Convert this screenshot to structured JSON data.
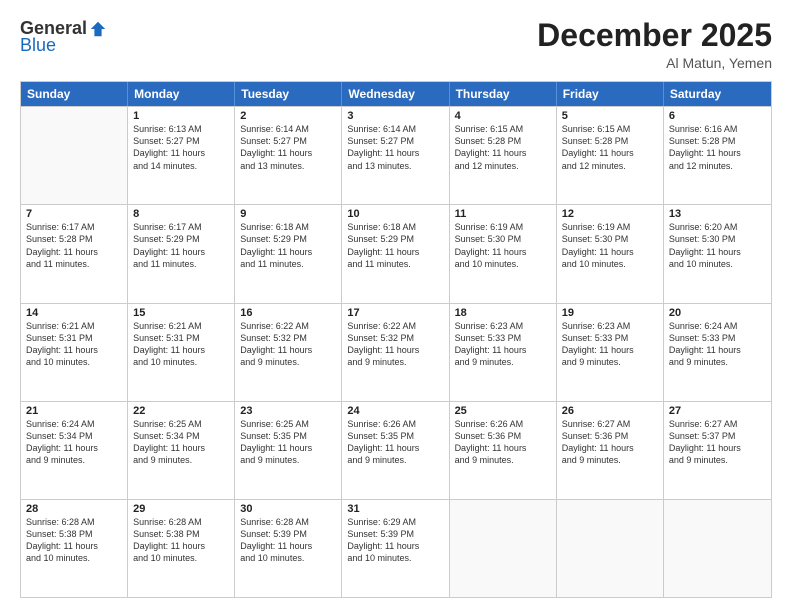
{
  "logo": {
    "general": "General",
    "blue": "Blue"
  },
  "header": {
    "month": "December 2025",
    "location": "Al Matun, Yemen"
  },
  "weekdays": [
    "Sunday",
    "Monday",
    "Tuesday",
    "Wednesday",
    "Thursday",
    "Friday",
    "Saturday"
  ],
  "rows": [
    [
      {
        "day": "",
        "info": ""
      },
      {
        "day": "1",
        "info": "Sunrise: 6:13 AM\nSunset: 5:27 PM\nDaylight: 11 hours\nand 14 minutes."
      },
      {
        "day": "2",
        "info": "Sunrise: 6:14 AM\nSunset: 5:27 PM\nDaylight: 11 hours\nand 13 minutes."
      },
      {
        "day": "3",
        "info": "Sunrise: 6:14 AM\nSunset: 5:27 PM\nDaylight: 11 hours\nand 13 minutes."
      },
      {
        "day": "4",
        "info": "Sunrise: 6:15 AM\nSunset: 5:28 PM\nDaylight: 11 hours\nand 12 minutes."
      },
      {
        "day": "5",
        "info": "Sunrise: 6:15 AM\nSunset: 5:28 PM\nDaylight: 11 hours\nand 12 minutes."
      },
      {
        "day": "6",
        "info": "Sunrise: 6:16 AM\nSunset: 5:28 PM\nDaylight: 11 hours\nand 12 minutes."
      }
    ],
    [
      {
        "day": "7",
        "info": "Sunrise: 6:17 AM\nSunset: 5:28 PM\nDaylight: 11 hours\nand 11 minutes."
      },
      {
        "day": "8",
        "info": "Sunrise: 6:17 AM\nSunset: 5:29 PM\nDaylight: 11 hours\nand 11 minutes."
      },
      {
        "day": "9",
        "info": "Sunrise: 6:18 AM\nSunset: 5:29 PM\nDaylight: 11 hours\nand 11 minutes."
      },
      {
        "day": "10",
        "info": "Sunrise: 6:18 AM\nSunset: 5:29 PM\nDaylight: 11 hours\nand 11 minutes."
      },
      {
        "day": "11",
        "info": "Sunrise: 6:19 AM\nSunset: 5:30 PM\nDaylight: 11 hours\nand 10 minutes."
      },
      {
        "day": "12",
        "info": "Sunrise: 6:19 AM\nSunset: 5:30 PM\nDaylight: 11 hours\nand 10 minutes."
      },
      {
        "day": "13",
        "info": "Sunrise: 6:20 AM\nSunset: 5:30 PM\nDaylight: 11 hours\nand 10 minutes."
      }
    ],
    [
      {
        "day": "14",
        "info": "Sunrise: 6:21 AM\nSunset: 5:31 PM\nDaylight: 11 hours\nand 10 minutes."
      },
      {
        "day": "15",
        "info": "Sunrise: 6:21 AM\nSunset: 5:31 PM\nDaylight: 11 hours\nand 10 minutes."
      },
      {
        "day": "16",
        "info": "Sunrise: 6:22 AM\nSunset: 5:32 PM\nDaylight: 11 hours\nand 9 minutes."
      },
      {
        "day": "17",
        "info": "Sunrise: 6:22 AM\nSunset: 5:32 PM\nDaylight: 11 hours\nand 9 minutes."
      },
      {
        "day": "18",
        "info": "Sunrise: 6:23 AM\nSunset: 5:33 PM\nDaylight: 11 hours\nand 9 minutes."
      },
      {
        "day": "19",
        "info": "Sunrise: 6:23 AM\nSunset: 5:33 PM\nDaylight: 11 hours\nand 9 minutes."
      },
      {
        "day": "20",
        "info": "Sunrise: 6:24 AM\nSunset: 5:33 PM\nDaylight: 11 hours\nand 9 minutes."
      }
    ],
    [
      {
        "day": "21",
        "info": "Sunrise: 6:24 AM\nSunset: 5:34 PM\nDaylight: 11 hours\nand 9 minutes."
      },
      {
        "day": "22",
        "info": "Sunrise: 6:25 AM\nSunset: 5:34 PM\nDaylight: 11 hours\nand 9 minutes."
      },
      {
        "day": "23",
        "info": "Sunrise: 6:25 AM\nSunset: 5:35 PM\nDaylight: 11 hours\nand 9 minutes."
      },
      {
        "day": "24",
        "info": "Sunrise: 6:26 AM\nSunset: 5:35 PM\nDaylight: 11 hours\nand 9 minutes."
      },
      {
        "day": "25",
        "info": "Sunrise: 6:26 AM\nSunset: 5:36 PM\nDaylight: 11 hours\nand 9 minutes."
      },
      {
        "day": "26",
        "info": "Sunrise: 6:27 AM\nSunset: 5:36 PM\nDaylight: 11 hours\nand 9 minutes."
      },
      {
        "day": "27",
        "info": "Sunrise: 6:27 AM\nSunset: 5:37 PM\nDaylight: 11 hours\nand 9 minutes."
      }
    ],
    [
      {
        "day": "28",
        "info": "Sunrise: 6:28 AM\nSunset: 5:38 PM\nDaylight: 11 hours\nand 10 minutes."
      },
      {
        "day": "29",
        "info": "Sunrise: 6:28 AM\nSunset: 5:38 PM\nDaylight: 11 hours\nand 10 minutes."
      },
      {
        "day": "30",
        "info": "Sunrise: 6:28 AM\nSunset: 5:39 PM\nDaylight: 11 hours\nand 10 minutes."
      },
      {
        "day": "31",
        "info": "Sunrise: 6:29 AM\nSunset: 5:39 PM\nDaylight: 11 hours\nand 10 minutes."
      },
      {
        "day": "",
        "info": ""
      },
      {
        "day": "",
        "info": ""
      },
      {
        "day": "",
        "info": ""
      }
    ]
  ]
}
